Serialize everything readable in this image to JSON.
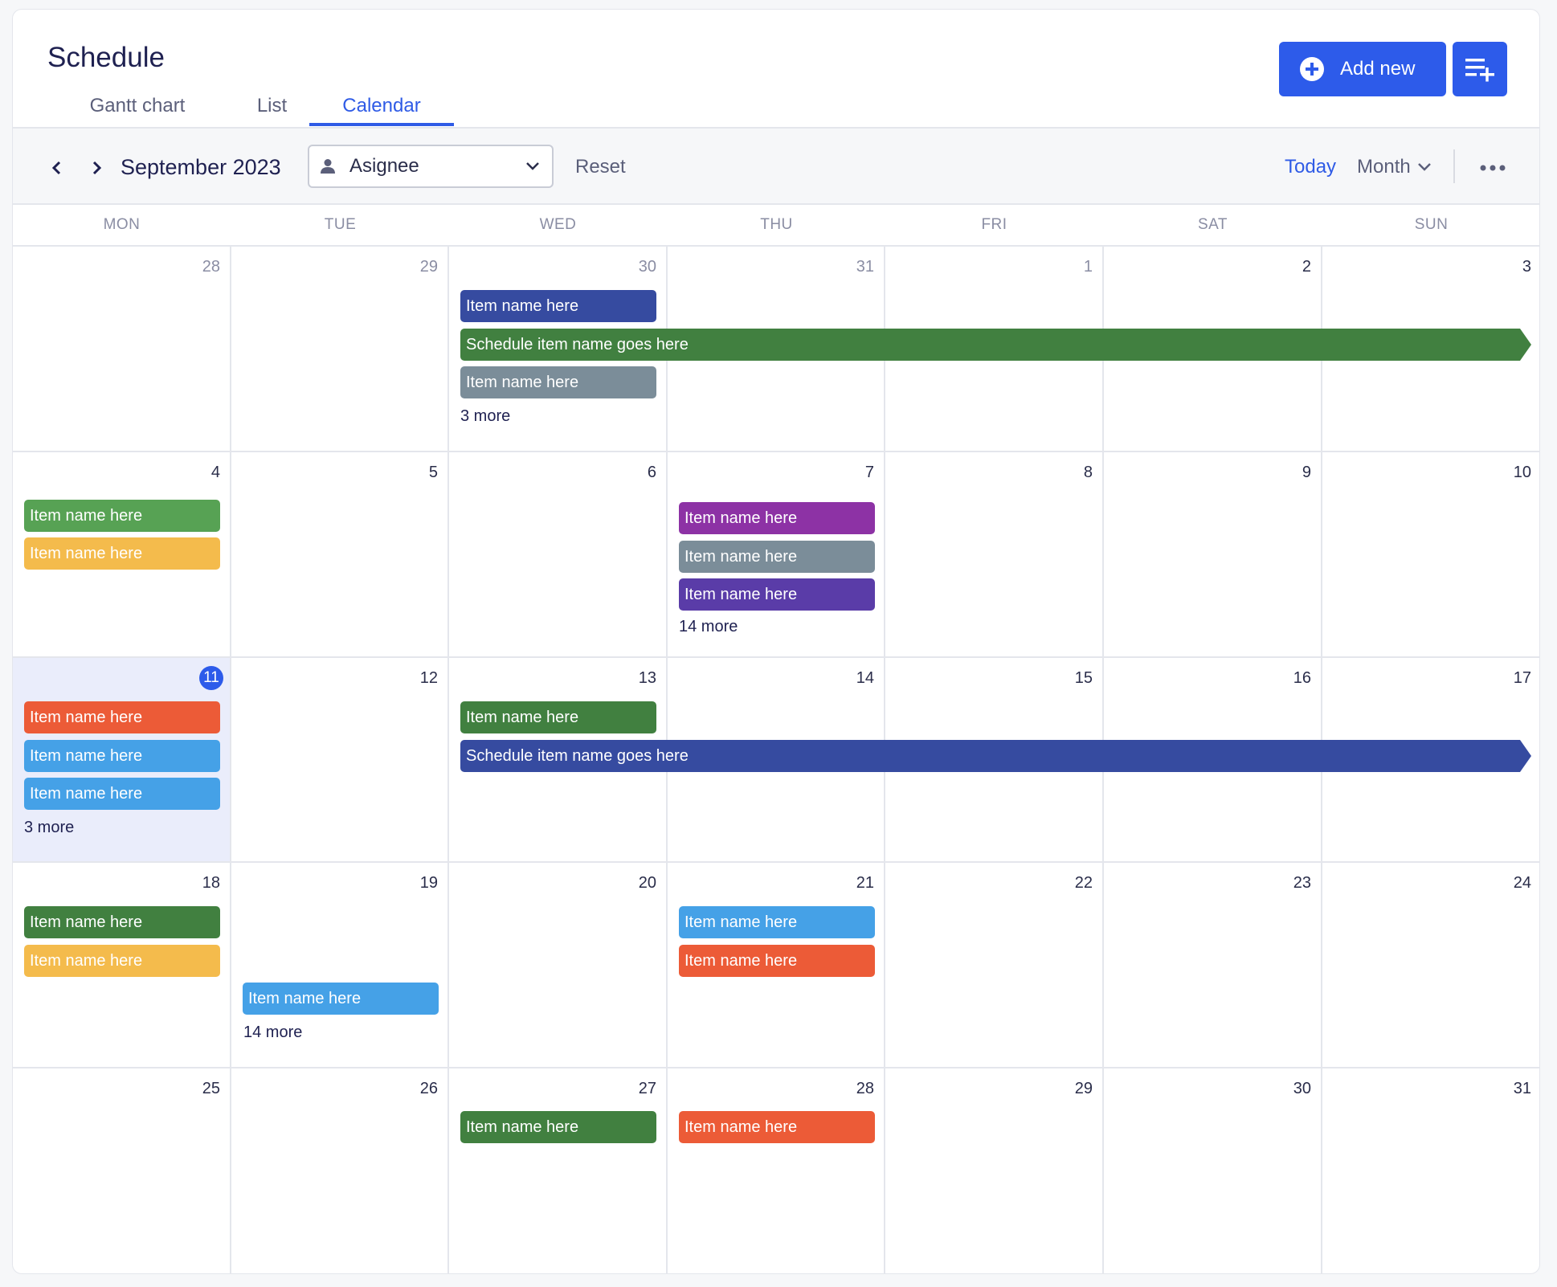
{
  "header": {
    "title": "Schedule",
    "tabs": [
      "Gantt chart",
      "List",
      "Calendar"
    ],
    "active_tab": "Calendar",
    "add_new_label": "Add new"
  },
  "toolbar": {
    "month_label": "September 2023",
    "assignee_label": "Asignee",
    "reset_label": "Reset",
    "today_label": "Today",
    "view_label": "Month"
  },
  "weekdays": [
    "MON",
    "TUE",
    "WED",
    "THU",
    "FRI",
    "SAT",
    "SUN"
  ],
  "weeks": [
    [
      "28",
      "29",
      "30",
      "31",
      "1",
      "2",
      "3"
    ],
    [
      "4",
      "5",
      "6",
      "7",
      "8",
      "9",
      "10"
    ],
    [
      "11",
      "12",
      "13",
      "14",
      "15",
      "16",
      "17"
    ],
    [
      "18",
      "19",
      "20",
      "21",
      "22",
      "23",
      "24"
    ],
    [
      "25",
      "26",
      "27",
      "28",
      "29",
      "30",
      "31"
    ]
  ],
  "today": "11",
  "colors": {
    "accent": "#2d5bea",
    "navy": "#364ba0",
    "green": "#418040",
    "light_green": "#57a254",
    "gray": "#7b8d99",
    "yellow": "#f4bb4c",
    "purple": "#8d32a5",
    "violet": "#5a3ca8",
    "orange": "#ec5b37",
    "blue": "#45a1e7"
  },
  "events": [
    {
      "label": "Item name here",
      "color": "navy"
    },
    {
      "label": "Schedule item name goes here",
      "color": "green"
    },
    {
      "label": "Item name here",
      "color": "gray"
    },
    {
      "label": "Item name here",
      "color": "light_green"
    },
    {
      "label": "Item name here",
      "color": "yellow"
    },
    {
      "label": "Item name here",
      "color": "purple"
    },
    {
      "label": "Item name here",
      "color": "gray"
    },
    {
      "label": "Item name here",
      "color": "violet"
    },
    {
      "label": "Item name here",
      "color": "orange"
    },
    {
      "label": "Item name here",
      "color": "blue"
    },
    {
      "label": "Item name here",
      "color": "blue"
    },
    {
      "label": "Item name here",
      "color": "green"
    },
    {
      "label": "Schedule item name goes here",
      "color": "navy"
    },
    {
      "label": "Item name here",
      "color": "green"
    },
    {
      "label": "Item name here",
      "color": "yellow"
    },
    {
      "label": "Item name here",
      "color": "blue"
    },
    {
      "label": "Item name here",
      "color": "blue"
    },
    {
      "label": "Item name here",
      "color": "orange"
    },
    {
      "label": "Item name here",
      "color": "green"
    },
    {
      "label": "Item name here",
      "color": "orange"
    }
  ],
  "more_links": [
    "3 more",
    "14 more",
    "3 more",
    "14 more"
  ]
}
